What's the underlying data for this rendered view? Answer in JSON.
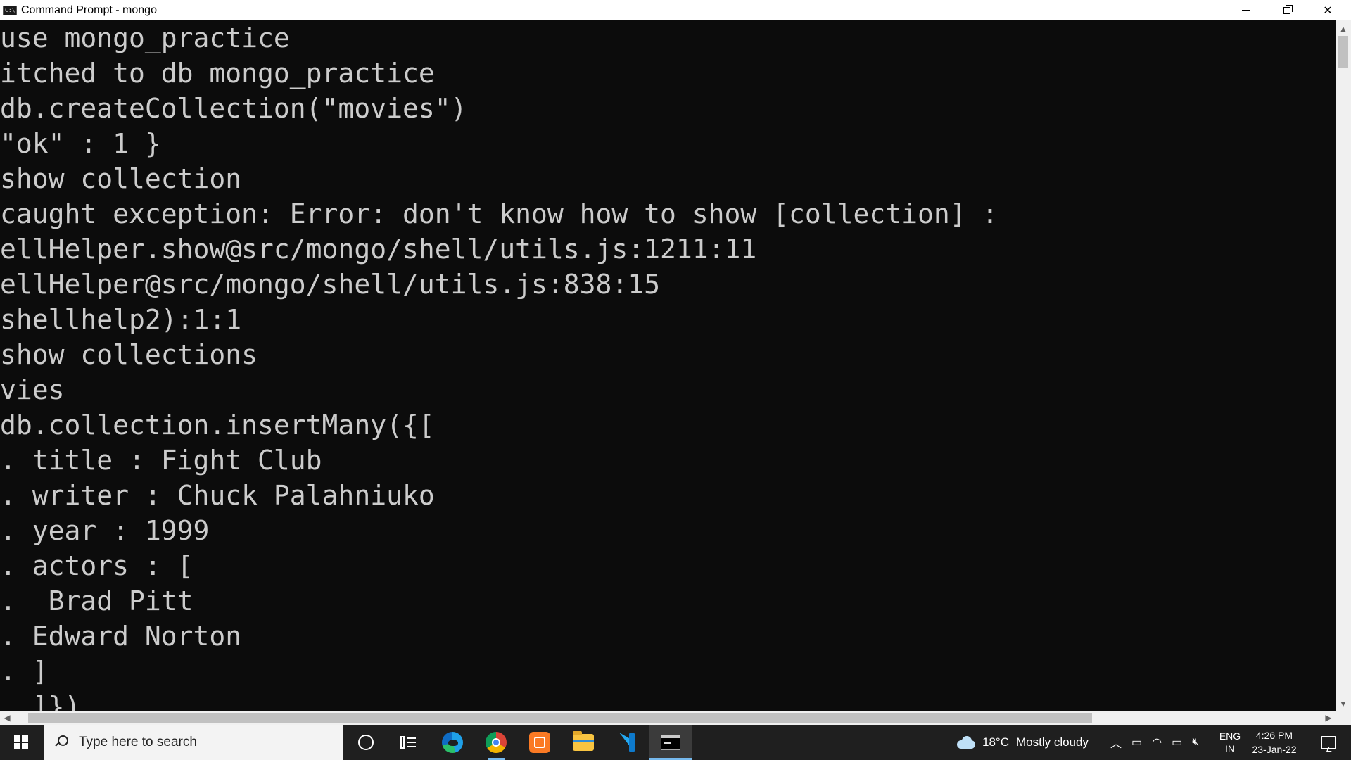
{
  "window": {
    "title": "Command Prompt - mongo",
    "app_icon_text": "C:\\"
  },
  "console": {
    "lines": [
      "use mongo_practice",
      "itched to db mongo_practice",
      "db.createCollection(\"movies\")",
      "\"ok\" : 1 }",
      "show collection",
      "caught exception: Error: don't know how to show [collection] :",
      "ellHelper.show@src/mongo/shell/utils.js:1211:11",
      "ellHelper@src/mongo/shell/utils.js:838:15",
      "shellhelp2):1:1",
      "show collections",
      "vies",
      "db.collection.insertMany({[",
      ". title : Fight Club",
      ". writer : Chuck Palahniuko",
      ". year : 1999",
      ". actors : [",
      ".  Brad Pitt",
      ". Edward Norton",
      ". ]",
      "  ]})"
    ]
  },
  "taskbar": {
    "search_placeholder": "Type here to search",
    "apps": [
      {
        "name": "cortana",
        "icon": "cortana-icon"
      },
      {
        "name": "task-view",
        "icon": "task-view-icon"
      },
      {
        "name": "microsoft-edge",
        "icon": "edge-icon"
      },
      {
        "name": "google-chrome",
        "icon": "chrome-icon"
      },
      {
        "name": "xampp",
        "icon": "xampp-icon"
      },
      {
        "name": "file-explorer",
        "icon": "folder-icon"
      },
      {
        "name": "visual-studio-code",
        "icon": "vscode-icon"
      },
      {
        "name": "command-prompt",
        "icon": "cmd-icon"
      }
    ],
    "weather": {
      "temperature": "18°C",
      "condition": "Mostly cloudy"
    },
    "language": {
      "line1": "ENG",
      "line2": "IN"
    },
    "clock": {
      "time": "4:26 PM",
      "date": "23-Jan-22"
    }
  },
  "colors": {
    "console_bg": "#0c0c0c",
    "console_fg": "#cccccc",
    "taskbar_bg": "#1f1f1f",
    "accent": "#76b9ed"
  }
}
